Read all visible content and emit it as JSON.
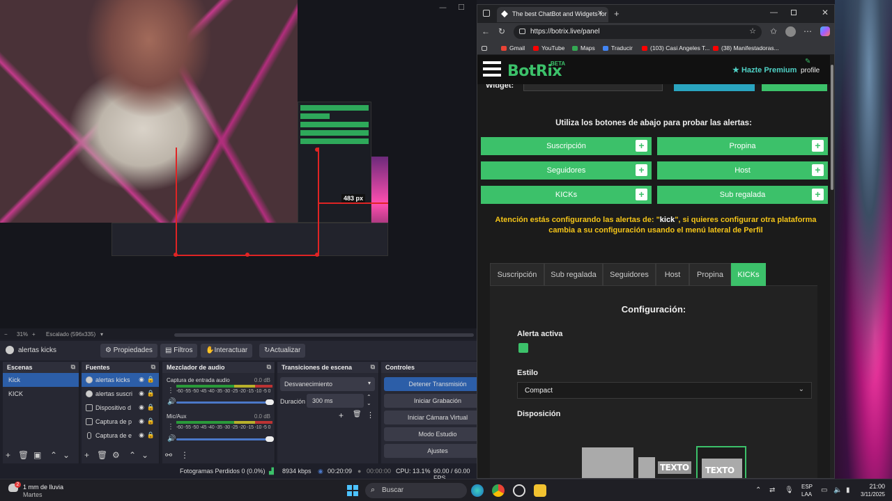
{
  "obs": {
    "preview_size_label": "483 px",
    "zoom": "31%",
    "scaled": "Escalado (596x335)",
    "current_scene": "alertas kicks",
    "ctx_buttons": {
      "properties": "Propiedades",
      "filters": "Filtros",
      "interact": "Interactuar",
      "refresh": "Actualizar"
    },
    "docks": {
      "scenes": "Escenas",
      "sources": "Fuentes",
      "mixer": "Mezclador de audio",
      "transitions": "Transiciones de escena",
      "controls": "Controles"
    },
    "scenes": [
      "Kick",
      "KICK"
    ],
    "sources": [
      "alertas kicks",
      "alertas suscri",
      "Dispositivo d",
      "Captura de p",
      "Captura de e"
    ],
    "mixer": [
      {
        "name": "Captura de entrada audio",
        "db": "0.0 dB"
      },
      {
        "name": "Mic/Aux",
        "db": "0.0 dB"
      }
    ],
    "meter_scale": "-60 -55 -50 -45 -40 -35 -30 -25 -20 -15 -10 -5 0",
    "transition": "Desvanecimiento",
    "duration_label": "Duración",
    "duration": "300 ms",
    "controls": [
      "Detener Transmisión",
      "Iniciar Grabación",
      "Iniciar Cámara Virtual",
      "Modo Estudio",
      "Ajustes"
    ],
    "status": {
      "dropped": "Fotogramas Perdidos 0 (0.0%)",
      "kbps": "8934 kbps",
      "live_time": "00:20:09",
      "rec_time": "00:00:00",
      "cpu": "CPU: 13.1%",
      "fps": "60.00 / 60.00 FPS"
    }
  },
  "browser": {
    "tab_title": "The best ChatBot and Widgets for",
    "url": "https://botrix.live/panel",
    "bookmarks": [
      "Gmail",
      "YouTube",
      "Maps",
      "Traducir",
      "(103) Casi Angeles T...",
      "(38) Manifestadoras..."
    ]
  },
  "botrix": {
    "brand": "BotRix",
    "beta": "BETA",
    "premium": "Hazte Premium",
    "profile": "profile",
    "widget_label": "Widget:",
    "test_heading": "Utiliza los botones de abajo para probar las alertas:",
    "alert_buttons": [
      "Suscripción",
      "Propina",
      "Seguidores",
      "Host",
      "KICKs",
      "Sub regalada"
    ],
    "warning_pre": "Atención estás configurando las alertas de: \"",
    "warning_platform": "kick",
    "warning_post": "\", si quieres configurar otra plataforma cambia a su configuración usando el menú lateral de Perfil",
    "tabs": [
      "Suscripción",
      "Sub regalada",
      "Seguidores",
      "Host",
      "Propina",
      "KICKs"
    ],
    "active_tab": "KICKs",
    "config_title": "Configuración:",
    "active_label": "Alerta activa",
    "style_label": "Estilo",
    "style_value": "Compact",
    "layout_label": "Disposición",
    "texto": "TEXTO",
    "accent": "#3cc16a"
  },
  "taskbar": {
    "weather_badge": "2",
    "weather": "1 mm de lluvia",
    "weather_day": "Martes",
    "search": "Buscar",
    "lang1": "ESP",
    "lang2": "LAA",
    "time": "21:00",
    "date": "3/11/2025"
  }
}
